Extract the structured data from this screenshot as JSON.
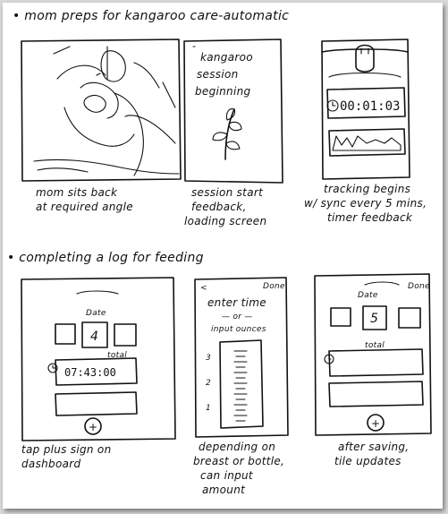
{
  "section1": {
    "heading": "• mom preps for kangaroo care-automatic",
    "panel1": {
      "caption_line1": "mom sits back",
      "caption_line2": "at required angle"
    },
    "panel2": {
      "screen_line1": "kangaroo",
      "screen_line2": "session",
      "screen_line3": "beginning",
      "caption_line1": "session start",
      "caption_line2": "feedback,",
      "caption_line3": "loading screen"
    },
    "panel3": {
      "timer": "00:01:03",
      "caption_line1": "tracking begins",
      "caption_line2": "w/ sync every 5 mins,",
      "caption_line3": "timer feedback"
    }
  },
  "section2": {
    "heading": "• completing a log for feeding",
    "panel1": {
      "date_label": "Date",
      "date_value": "4",
      "total_label": "total",
      "timer": "07:43:00",
      "plus": "+",
      "caption_line1": "tap plus sign on",
      "caption_line2": "dashboard"
    },
    "panel2": {
      "back": "<",
      "done": "Done",
      "prompt_line1": "enter time",
      "prompt_line2": "— or —",
      "prompt_line3": "input ounces",
      "scale": [
        "3",
        "2",
        "1"
      ],
      "caption_line1": "depending on",
      "caption_line2": "breast or bottle,",
      "caption_line3": "can input",
      "caption_line4": "amount"
    },
    "panel3": {
      "done": "Done",
      "date_label": "Date",
      "date_value": "5",
      "total_label": "total",
      "plus": "+",
      "caption_line1": "after saving,",
      "caption_line2": "tile updates"
    }
  }
}
